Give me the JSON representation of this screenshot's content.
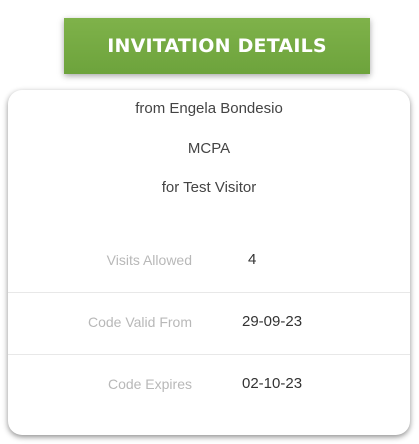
{
  "header": {
    "title": "INVITATION DETAILS"
  },
  "invitation": {
    "from_line": "from Engela Bondesio",
    "company": "MCPA",
    "visitor_line": "for Test Visitor"
  },
  "details": [
    {
      "label": "Visits Allowed",
      "value": "4"
    },
    {
      "label": "Code Valid From",
      "value": "29-09-23"
    },
    {
      "label": "Code Expires",
      "value": "02-10-23"
    }
  ],
  "colors": {
    "header_bg": "#76ab43",
    "header_text": "#ffffff",
    "label_text": "#b8b8b8",
    "value_text": "#333333"
  }
}
